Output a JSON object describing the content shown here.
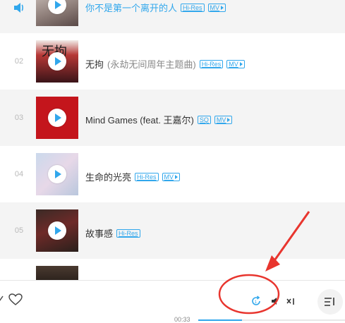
{
  "colors": {
    "accent": "#31a7ec",
    "annotation": "#e8352e",
    "row_alt": "#f4f4f4"
  },
  "tracks": [
    {
      "number": "",
      "title": "你不是第一个离开的人",
      "subtitle": "",
      "badges": [
        "Hi-Res",
        "MV"
      ],
      "playing": true,
      "cover_icon": "album-cover-dark-portrait"
    },
    {
      "number": "02",
      "title": "无拘",
      "subtitle": "(永劫无间周年主题曲)",
      "badges": [
        "Hi-Res",
        "MV"
      ],
      "playing": false,
      "cover_icon": "album-cover-wuju"
    },
    {
      "number": "03",
      "title": "Mind Games (feat. 王嘉尔)",
      "subtitle": "",
      "badges": [
        "SQ",
        "MV"
      ],
      "playing": false,
      "cover_icon": "album-cover-red"
    },
    {
      "number": "04",
      "title": "生命的光亮",
      "subtitle": "",
      "badges": [
        "Hi-Res",
        "MV"
      ],
      "playing": false,
      "cover_icon": "album-cover-pastel"
    },
    {
      "number": "05",
      "title": "故事感",
      "subtitle": "",
      "badges": [
        "Hi-Res"
      ],
      "playing": false,
      "cover_icon": "album-cover-dark-red"
    }
  ],
  "player": {
    "time": "00:33",
    "progress_fraction": 0.3,
    "icons": [
      "share-icon",
      "heart-icon",
      "loop-icon",
      "volume-icon",
      "lyrics-icon",
      "playlist-icon"
    ]
  }
}
